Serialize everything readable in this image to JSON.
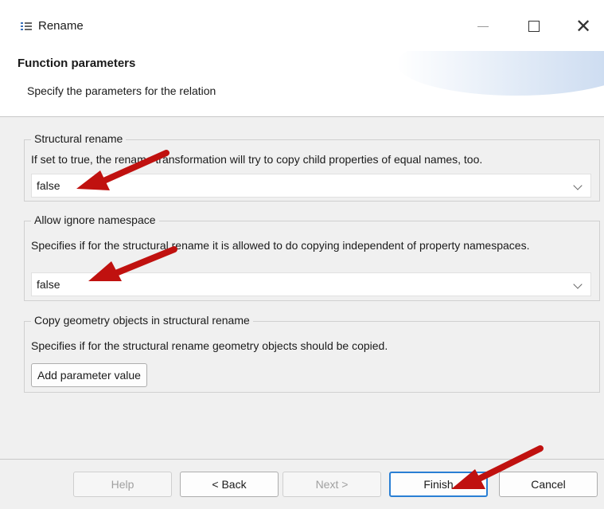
{
  "window": {
    "title": "Rename",
    "app_icon": "list-icon",
    "minimize_icon": "minimize-icon",
    "maximize_icon": "maximize-icon",
    "close_glyph": "✕"
  },
  "header": {
    "title": "Function parameters",
    "subtitle": "Specify the parameters for the relation"
  },
  "groups": [
    {
      "legend": "Structural rename",
      "description": "If set to true, the rename transformation will try to copy child properties of equal names, too.",
      "value": "false"
    },
    {
      "legend": "Allow ignore namespace",
      "description": "Specifies if for the structural rename it is allowed to do copying independent of property namespaces.",
      "value": "false"
    },
    {
      "legend": "Copy geometry objects in structural rename",
      "description": "Specifies if for the structural rename geometry objects should be copied.",
      "add_button": "Add parameter value"
    }
  ],
  "footer": {
    "help": "Help",
    "back": "< Back",
    "next": "Next >",
    "finish": "Finish",
    "cancel": "Cancel"
  },
  "annotation_color": "#c0110f"
}
